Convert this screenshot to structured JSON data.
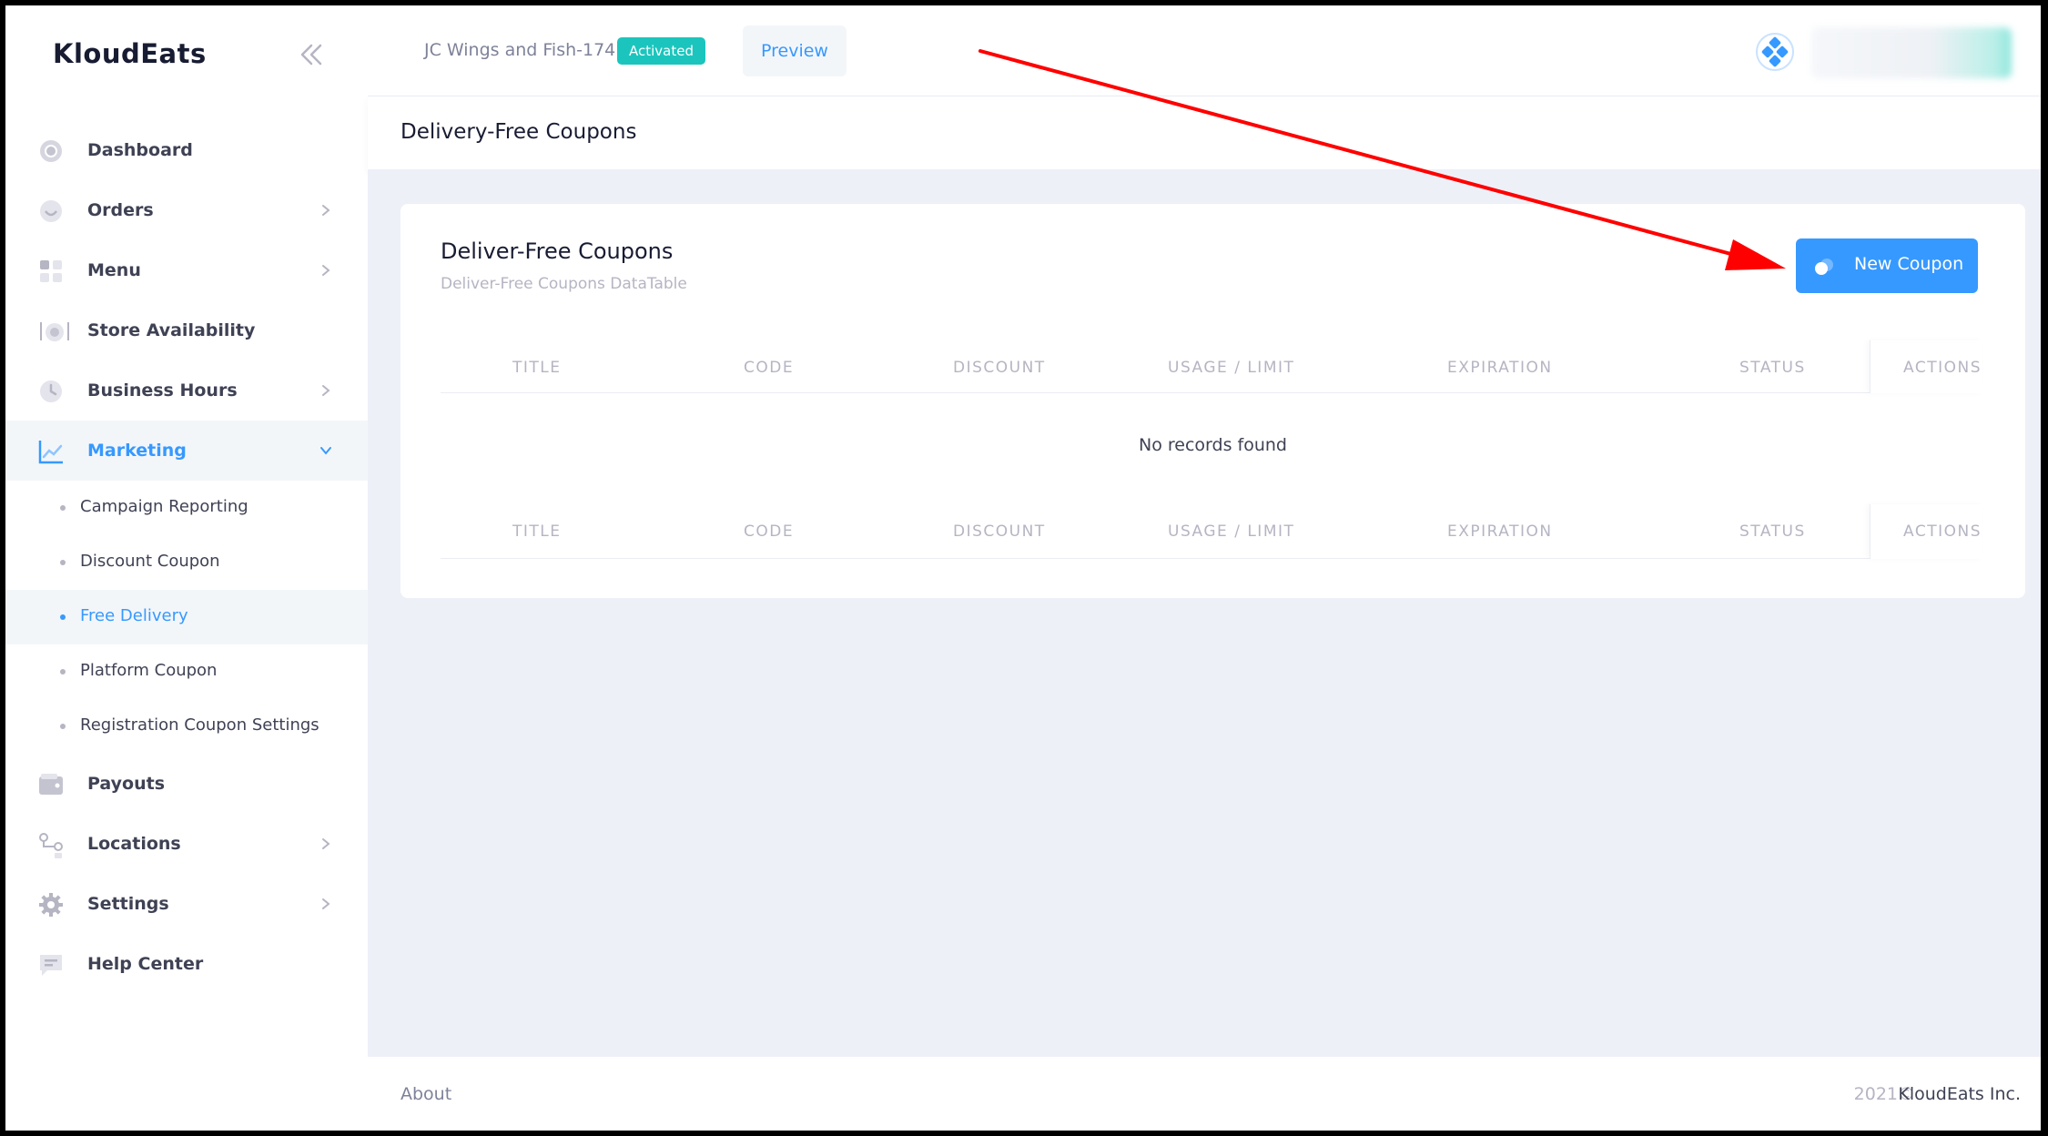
{
  "sidebar": {
    "brand": "KloudEats",
    "items": [
      {
        "label": "Dashboard",
        "icon": "dashboard-icon"
      },
      {
        "label": "Orders",
        "icon": "orders-icon"
      },
      {
        "label": "Menu",
        "icon": "menu-icon"
      },
      {
        "label": "Store Availability",
        "icon": "store-availability-icon"
      },
      {
        "label": "Business Hours",
        "icon": "clock-icon"
      },
      {
        "label": "Marketing",
        "icon": "chart-icon"
      },
      {
        "label": "Payouts",
        "icon": "wallet-icon"
      },
      {
        "label": "Locations",
        "icon": "locations-icon"
      },
      {
        "label": "Settings",
        "icon": "gear-icon"
      },
      {
        "label": "Help Center",
        "icon": "chat-icon"
      }
    ],
    "marketing_sub": [
      {
        "label": "Campaign Reporting"
      },
      {
        "label": "Discount Coupon"
      },
      {
        "label": "Free Delivery"
      },
      {
        "label": "Platform Coupon"
      },
      {
        "label": "Registration Coupon Settings"
      }
    ]
  },
  "header": {
    "store_name": "JC Wings and Fish-174",
    "status_badge": "Activated",
    "preview_label": "Preview"
  },
  "subheader": {
    "title": "Delivery-Free Coupons"
  },
  "card": {
    "title": "Deliver-Free Coupons",
    "subtitle": "Deliver-Free Coupons DataTable",
    "new_button": "New Coupon",
    "columns": [
      "Title",
      "Code",
      "Discount",
      "Usage / Limit",
      "Expiration",
      "Status",
      "Actions"
    ],
    "empty_message": "No records found"
  },
  "footer": {
    "about": "About",
    "year": "2021©",
    "company": "KloudEats Inc."
  },
  "colors": {
    "accent": "#3699ff",
    "badge": "#1bc5bd",
    "annotation_arrow": "#ff0000",
    "content_bg": "#eef0f8"
  }
}
